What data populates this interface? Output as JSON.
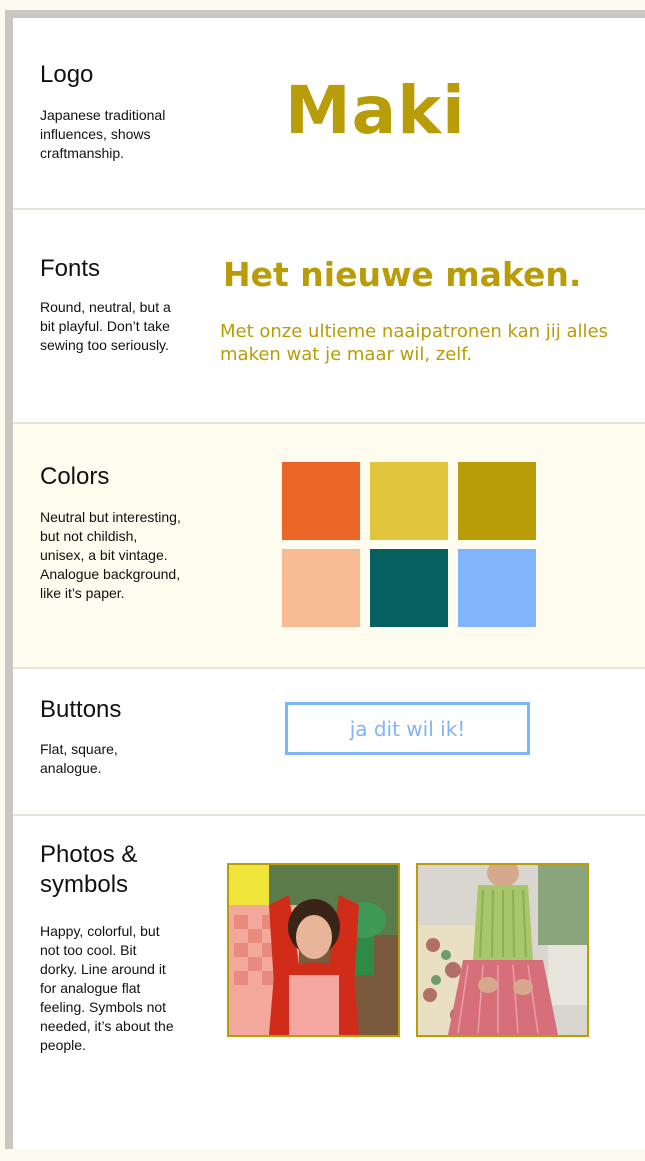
{
  "logo": {
    "title": "Logo",
    "description": "Japanese traditional influences, shows craftmanship.",
    "wordmark": "Maki"
  },
  "fonts": {
    "title": "Fonts",
    "description": "Round, neutral, but a bit playful. Don’t take sewing too seriously.",
    "headline_sample": "Het nieuwe maken.",
    "body_sample": "Met onze ultieme naaipatronen kan jij alles maken wat je maar wil, zelf."
  },
  "colors": {
    "title": "Colors",
    "description": "Neutral but interesting, but not childish, unisex, a bit vintage. Analogue background, like it’s paper.",
    "palette": [
      "#ea6526",
      "#e0c53d",
      "#b89c08",
      "#f7bc94",
      "#066060",
      "#80b4fb"
    ]
  },
  "buttons": {
    "title": "Buttons",
    "description": "Flat, square, analogue.",
    "sample_label": "ja dit wil ik!"
  },
  "photos": {
    "title": "Photos & symbols",
    "description": "Happy, colorful, but not too cool. Bit dorky. Line around it for analogue flat feeling. Symbols not needed, it’s about the people."
  },
  "accent": "#b89c08",
  "button_color": "#7fb4f7"
}
